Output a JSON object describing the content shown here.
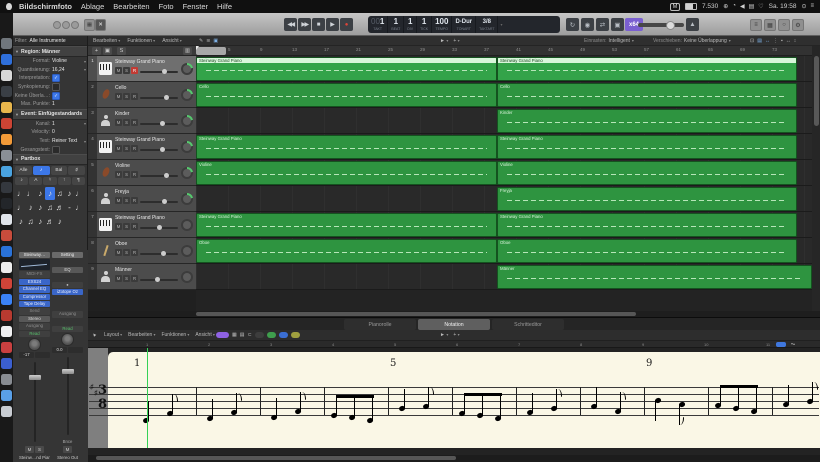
{
  "menubar": {
    "items": [
      "Bildschirmfoto",
      "Ablage",
      "Bearbeiten",
      "Foto",
      "Fenster",
      "Hilfe"
    ],
    "status": {
      "badge": "M",
      "battery": "7.530",
      "datetime": "Sa. 19:58"
    },
    "status_icons": [
      "plus",
      "clock",
      "volume",
      "display",
      "wifi"
    ],
    "status_icons_right": [
      "search",
      "list"
    ]
  },
  "toolbar": {
    "transport": [
      "rewind",
      "fast-forward",
      "stop",
      "play",
      "record"
    ],
    "mode_icons": [
      "cycle",
      "autopunch",
      "replace",
      "count-in"
    ],
    "varispeed_badge": "x64",
    "metronome": "metronome",
    "view_buttons": [
      "list-editors",
      "media",
      "note-pads",
      "tools"
    ],
    "lcd": {
      "prefix": "00",
      "bar": "1",
      "beat": "1",
      "div": "1",
      "tick": "1",
      "tempo": "100",
      "key": "D-Dur",
      "sig": "3/8",
      "labels": {
        "bar": "TAKT",
        "beat": "BEAT",
        "div": "DIV",
        "tick": "TICK",
        "tempo": "TEMPO",
        "key": "TONART",
        "sig": "TAKTART"
      }
    }
  },
  "dock_colors": [
    "#70767c",
    "#2f6fda",
    "#d8d8d8",
    "#3a3f45",
    "#e8b64c",
    "#cc4434",
    "#f29a38",
    "#8a8f96",
    "#4aa3e0",
    "#34383e",
    "#23262a",
    "#e0e4ea",
    "#c84c3c",
    "#2a72d8",
    "#ededed",
    "#d04438",
    "#3b82f6",
    "#b83a30",
    "#f0f0f2",
    "#c94040",
    "#3b5fd0",
    "#888c92",
    "#5aa0e8",
    "#c8ccd2"
  ],
  "inspector": {
    "filter_label": "Filter:",
    "filter_value": "Alle Instrumente",
    "region_section": {
      "title": "Region: Männer",
      "rows": [
        {
          "label": "Format:",
          "value": "Violine",
          "stepper": true
        },
        {
          "label": "Quantisierung:",
          "value": "16,24",
          "stepper": true
        },
        {
          "label": "Interpretation:",
          "checkbox": true,
          "checked": true
        },
        {
          "label": "Synkopierung:",
          "checkbox": true,
          "checked": false
        },
        {
          "label": "Keine Überla…:",
          "checkbox": true,
          "checked": true
        },
        {
          "label": "Max. Punkte:",
          "value": "1"
        }
      ]
    },
    "event_section": {
      "title": "Event: Einfügestandards",
      "rows": [
        {
          "label": "Kanal:",
          "value": "1",
          "stepper": true
        },
        {
          "label": "Velocity:",
          "value": "0"
        },
        {
          "label": "Text:",
          "value": "Reiner Text",
          "stepper": true
        },
        {
          "label": "Gesangstext:",
          "checkbox": true,
          "checked": false
        }
      ]
    },
    "partbox": {
      "title": "Partbox",
      "tabs": [
        "Alle",
        "♪",
        "Bal",
        "♯"
      ],
      "active_tab": 1,
      "tabs2": [
        "♪",
        "A",
        "♮",
        "↑",
        "¶"
      ],
      "cells": [
        [
          "♩",
          "♩",
          "♪",
          "♪",
          "♫",
          "♪",
          "♩"
        ],
        [
          "♩",
          "♪",
          "♪",
          "♫",
          "♬",
          "-"
        ],
        [
          "♩",
          "♪",
          "♫",
          "♪",
          "♬",
          "♪"
        ]
      ],
      "selected_cell": [
        0,
        3
      ]
    }
  },
  "strips": [
    {
      "name": "Steinw…nd Piano",
      "value": "-17",
      "buttons": [
        "M",
        "S"
      ],
      "fader": 0.35,
      "slots": [
        {
          "t": "Steinway…",
          "c": "set"
        },
        {
          "c": "eqgraph"
        },
        {
          "t": "MIDI-FX",
          "c": "dim"
        },
        {
          "t": "EXS24",
          "c": "blue"
        },
        {
          "t": "Channel EQ",
          "c": "blue"
        },
        {
          "t": "Compressor",
          "c": "blue"
        },
        {
          "t": "Tape Delay",
          "c": "blue"
        },
        {
          "t": "Send",
          "c": "dim"
        },
        {
          "t": "Stereo",
          "c": "gray"
        },
        {
          "t": "Ausgang",
          "c": "dim"
        },
        {
          "t": "Read",
          "c": "read"
        }
      ]
    },
    {
      "name": "Stereo Out",
      "value": "0.0",
      "buttons": [
        "M"
      ],
      "bounce": "Bnce",
      "fader": 0.3,
      "slots": [
        {
          "t": "Setting",
          "c": "set"
        },
        {
          "c": "sp"
        },
        {
          "t": "EQ",
          "c": "gray"
        },
        {
          "c": "sp"
        },
        {
          "t": "●",
          "c": "icon"
        },
        {
          "t": "iZotope Oz",
          "c": "blue"
        },
        {
          "c": "sp"
        },
        {
          "c": "sp"
        },
        {
          "t": "Ausgang",
          "c": "dim"
        },
        {
          "c": "sp"
        },
        {
          "t": "Read",
          "c": "read"
        }
      ]
    }
  ],
  "arrange": {
    "menus": [
      "Bearbeiten",
      "Funktionen",
      "Ansicht"
    ],
    "snap_label": "Einrasten:",
    "snap_value": "Intelligent",
    "drag_label": "Verschieben:",
    "drag_value": "Keine Überlappung",
    "ruler_ticks": [
      5,
      9,
      13,
      17,
      21,
      25,
      29,
      33,
      37,
      41,
      45,
      49,
      53,
      57,
      61,
      65,
      69,
      73
    ]
  },
  "tracks": [
    {
      "num": "1",
      "name": "Steinway Grand Piano",
      "icon": "piano",
      "selected": true,
      "rec": true,
      "vol": 0.66,
      "pan_green": true
    },
    {
      "num": "2",
      "name": "Cello",
      "icon": "cello",
      "vol": 0.72,
      "pan_green": true
    },
    {
      "num": "3",
      "name": "Kinder",
      "icon": "choir",
      "vol": 0.6,
      "pan_green": true
    },
    {
      "num": "4",
      "name": "Steinway Grand Piano",
      "icon": "piano",
      "vol": 0.58,
      "pan_green": true
    },
    {
      "num": "5",
      "name": "Violine",
      "icon": "violin",
      "vol": 0.72,
      "pan_green": true
    },
    {
      "num": "6",
      "name": "Freyja",
      "icon": "singer",
      "vol": 0.66,
      "pan_green": true
    },
    {
      "num": "7",
      "name": "Steinway Grand Piano",
      "icon": "piano",
      "vol": 0.5
    },
    {
      "num": "8",
      "name": "Oboe",
      "icon": "oboe",
      "vol": 0.62
    },
    {
      "num": "9",
      "name": "Männer",
      "icon": "singer",
      "vol": 0.45
    }
  ],
  "regions": [
    {
      "a": {
        "name": "Steinway Grand Piano",
        "selected": true
      },
      "b": {
        "name": "Steinway Grand Piano",
        "selected": true
      }
    },
    {
      "a": {
        "name": "Cello"
      },
      "b": {
        "name": "Cello"
      }
    },
    {
      "a": null,
      "b": {
        "name": "Kinder"
      }
    },
    {
      "a": {
        "name": "Steinway Grand Piano"
      },
      "b": {
        "name": "Steinway Grand Piano"
      }
    },
    {
      "a": {
        "name": "Violine"
      },
      "b": {
        "name": "Violine"
      }
    },
    {
      "a": null,
      "b": {
        "name": "Freyja"
      }
    },
    {
      "a": {
        "name": "Steinway Grand Piano"
      },
      "b": {
        "name": "Steinway Grand Piano"
      }
    },
    {
      "a": {
        "name": "Oboe"
      },
      "b": {
        "name": "Oboe"
      }
    },
    {
      "a": null,
      "b": {
        "name": "Männer",
        "extend": true
      }
    }
  ],
  "editor": {
    "tabs": [
      "Pianorolle",
      "Notation",
      "Schritteditor"
    ],
    "active_tab": "Notation",
    "menus": [
      "Layout",
      "Bearbeiten",
      "Funktionen",
      "Ansicht"
    ],
    "ruler": [
      1,
      2,
      3,
      4,
      5,
      6,
      7,
      8,
      9,
      10,
      11
    ],
    "color_buttons": [
      {
        "name": "midi-in-button",
        "color": "#8f62e3"
      },
      {
        "name": "record-dot-button",
        "color": "#3d3d3d"
      },
      {
        "name": "step-input-button",
        "color": "#3f9e4d"
      },
      {
        "name": "midi-out-button",
        "color": "#3b6fd4"
      },
      {
        "name": "velocity-button",
        "color": "#9f9f3f"
      }
    ]
  },
  "score": {
    "timesig_num": "3",
    "timesig_den": "8",
    "key_sharps": 2,
    "measure_labels": [
      {
        "text": "1",
        "measure": 1
      },
      {
        "text": "5",
        "measure": 5
      },
      {
        "text": "9",
        "measure": 9
      }
    ],
    "measures": [
      {
        "t": "qe",
        "y": [
          33,
          26
        ]
      },
      {
        "t": "qe",
        "y": [
          31,
          25
        ]
      },
      {
        "t": "qe",
        "y": [
          30,
          24
        ]
      },
      {
        "t": "b3",
        "y": [
          28,
          30,
          33
        ]
      },
      {
        "t": "qe",
        "y": [
          21,
          19
        ]
      },
      {
        "t": "b3",
        "y": [
          26,
          28,
          31
        ]
      },
      {
        "t": "qe",
        "y": [
          25,
          21
        ]
      },
      {
        "t": "qe",
        "y": [
          19,
          24
        ]
      },
      {
        "t": "qe",
        "y": [
          13,
          17
        ],
        "stem": "down"
      },
      {
        "t": "b3",
        "y": [
          18,
          21,
          24
        ]
      },
      {
        "t": "qe",
        "y": [
          17,
          14
        ]
      }
    ]
  }
}
